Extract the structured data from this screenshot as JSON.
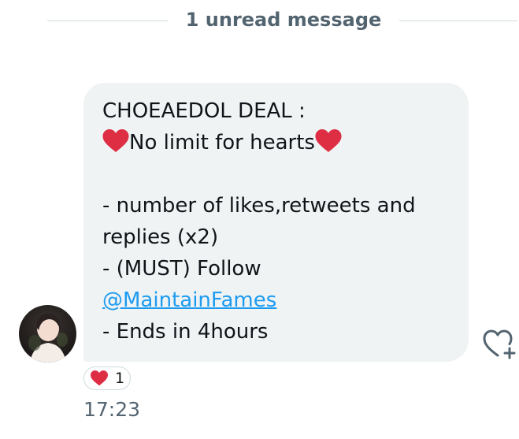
{
  "divider": {
    "label": "1 unread message"
  },
  "message": {
    "line1": "CHOEAEDOL DEAL :",
    "line2_text": "No limit for hearts",
    "line3": "- number of likes,retweets and",
    "line4": "replies (x2)",
    "line5": "- (MUST) Follow",
    "link": "@MaintainFames",
    "line7": "- Ends in 4hours"
  },
  "reaction": {
    "emoji": "red-heart-icon",
    "count": "1"
  },
  "timestamp": "17:23",
  "colors": {
    "bubble_bg": "#eff3f4",
    "link": "#1d9bf0",
    "heart": "#dd2e44",
    "secondary_text": "#536471",
    "divider_line": "#cfd9de"
  }
}
